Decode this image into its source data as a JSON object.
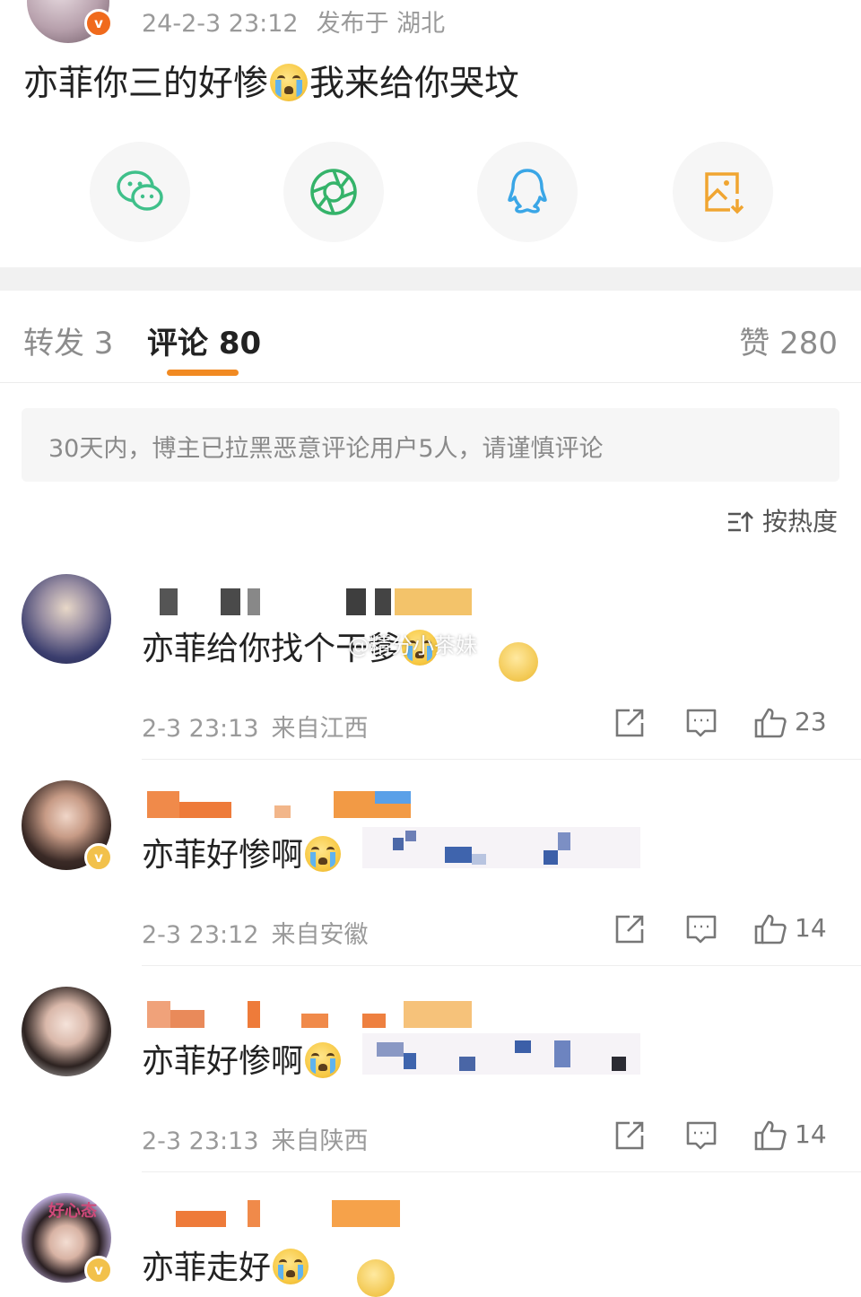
{
  "post": {
    "time": "24-2-3 23:12",
    "location": "发布于 湖北",
    "text_part1": "亦菲你三的好惨",
    "text_part2": "我来给你哭坟"
  },
  "share": {
    "items": [
      {
        "icon": "wechat-icon",
        "color": "#3fc08a"
      },
      {
        "icon": "moments-icon",
        "color": "#35b36a"
      },
      {
        "icon": "qq-icon",
        "color": "#3aa6e6"
      },
      {
        "icon": "save-image-icon",
        "color": "#f0a531"
      }
    ]
  },
  "tabs": {
    "forward": "转发 3",
    "comments": "评论 80",
    "likes": "赞 280"
  },
  "colors": {
    "accent": "#f18a22",
    "meta": "#9a9a9a"
  },
  "notice": "30天内，博主已拉黑恶意评论用户5人，请谨慎评论",
  "sort_label": "按热度",
  "watermark": "@精分小茶妹",
  "comments": [
    {
      "text": "亦菲给你找个干爹",
      "time": "2-3 23:13",
      "location": "来自江西",
      "likes": "23"
    },
    {
      "text": "亦菲好惨啊",
      "time": "2-3 23:12",
      "location": "来自安徽",
      "likes": "14"
    },
    {
      "text": "亦菲好惨啊",
      "time": "2-3 23:13",
      "location": "来自陕西",
      "likes": "14"
    },
    {
      "text": "亦菲走好",
      "avatar_text": "好心态"
    }
  ]
}
